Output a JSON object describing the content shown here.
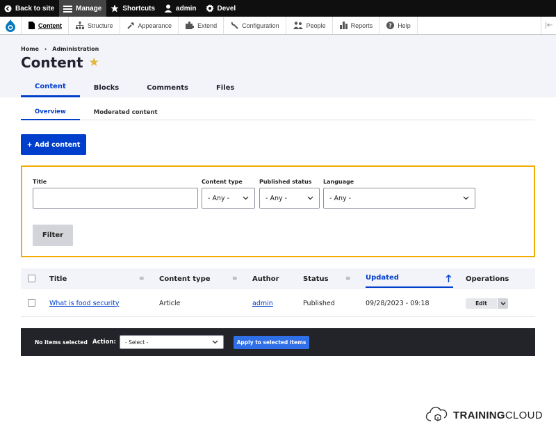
{
  "toolbar": {
    "items": [
      {
        "label": "Back to site",
        "icon": "back-arrow-icon"
      },
      {
        "label": "Manage",
        "icon": "hamburger-icon"
      },
      {
        "label": "Shortcuts",
        "icon": "star-icon"
      },
      {
        "label": "admin",
        "icon": "user-icon"
      },
      {
        "label": "Devel",
        "icon": "gear-icon"
      }
    ]
  },
  "tray": {
    "items": [
      {
        "label": "Content",
        "icon": "file-icon"
      },
      {
        "label": "Structure",
        "icon": "sitemap-icon"
      },
      {
        "label": "Appearance",
        "icon": "paintbrush-icon"
      },
      {
        "label": "Extend",
        "icon": "puzzle-icon"
      },
      {
        "label": "Configuration",
        "icon": "wrench-icon"
      },
      {
        "label": "People",
        "icon": "people-icon"
      },
      {
        "label": "Reports",
        "icon": "bar-chart-icon"
      },
      {
        "label": "Help",
        "icon": "help-icon"
      }
    ],
    "orientation_toggle": "|⇤"
  },
  "breadcrumb": {
    "home": "Home",
    "separator": "›",
    "administration": "Administration"
  },
  "page": {
    "title": "Content",
    "star": "★"
  },
  "tabs": [
    "Content",
    "Blocks",
    "Comments",
    "Files"
  ],
  "subtabs": [
    "Overview",
    "Moderated content"
  ],
  "add_content_label": "+ Add content",
  "filter": {
    "title_label": "Title",
    "title_value": "",
    "content_type_label": "Content type",
    "content_type_value": "- Any -",
    "published_label": "Published status",
    "published_value": "- Any -",
    "language_label": "Language",
    "language_value": "- Any -",
    "filter_button": "Filter"
  },
  "table": {
    "headers": {
      "title": "Title",
      "content_type": "Content type",
      "author": "Author",
      "status": "Status",
      "updated": "Updated",
      "operations": "Operations"
    },
    "rows": [
      {
        "title": "What is food security",
        "content_type": "Article",
        "author": "admin",
        "status": "Published",
        "updated": "09/28/2023 - 09:18",
        "operation": "Edit"
      }
    ]
  },
  "bulk": {
    "selected_text": "No items selected",
    "action_label": "Action:",
    "select_value": "- Select -",
    "apply_button": "Apply to selected items"
  },
  "watermark": {
    "bold": "TRAINING",
    "regular": "CLOUD"
  },
  "colors": {
    "accent": "#003ecc",
    "filter_border": "#f0ad00",
    "toolbar_bg": "#0f0f0f",
    "star": "#e4b33a"
  }
}
